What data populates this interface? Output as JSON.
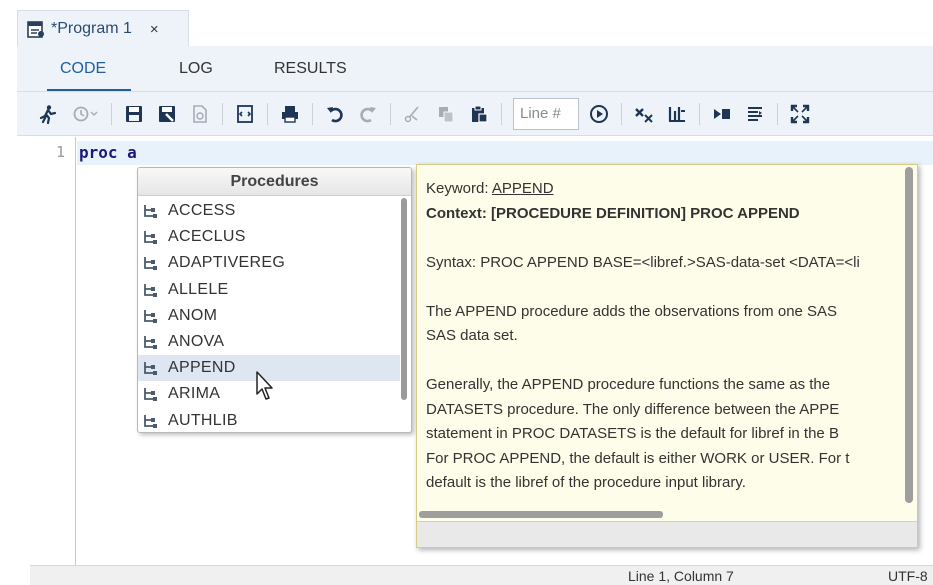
{
  "document_tab": {
    "title": "*Program 1",
    "close_glyph": "×",
    "icon": "sas-program-icon"
  },
  "subtabs": [
    {
      "label": "CODE",
      "active": true
    },
    {
      "label": "LOG",
      "active": false
    },
    {
      "label": "RESULTS",
      "active": false
    }
  ],
  "toolbar": {
    "line_placeholder": "Line #",
    "buttons": [
      "run-icon",
      "history-icon",
      "save-icon",
      "save-as-icon",
      "export-icon",
      "generate-code-icon",
      "print-icon",
      "undo-icon",
      "redo-icon",
      "cut-icon",
      "copy-icon",
      "paste-icon",
      "go-to-line-icon",
      "clear-icon",
      "format-icon",
      "snippet-icon",
      "options-icon",
      "maximize-icon"
    ]
  },
  "editor": {
    "line_number": "1",
    "code": "proc a"
  },
  "autocomplete": {
    "header": "Procedures",
    "items": [
      "ACCESS",
      "ACECLUS",
      "ADAPTIVEREG",
      "ALLELE",
      "ANOM",
      "ANOVA",
      "APPEND",
      "ARIMA",
      "AUTHLIB"
    ],
    "selected": "APPEND"
  },
  "help": {
    "keyword_label": "Keyword:",
    "keyword": "APPEND",
    "context": "Context: [PROCEDURE DEFINITION] PROC APPEND",
    "syntax": "Syntax: PROC APPEND BASE=<libref.>SAS-data-set <DATA=<li",
    "desc_line1": "The APPEND procedure adds the observations from one SAS",
    "desc_line2": "SAS data set.",
    "gen_line1": "Generally, the APPEND procedure functions the same as the",
    "gen_line2": "DATASETS procedure. The only difference between the APPE",
    "gen_line3": "statement in PROC DATASETS is the default for libref in the B",
    "gen_line4": "For PROC APPEND, the default is either WORK or USER. For t",
    "gen_line5": "default is the libref of the procedure input library."
  },
  "status": {
    "position": "Line 1, Column 7",
    "encoding": "UTF-8"
  },
  "colors": {
    "accent": "#1f5f9f",
    "toolbar_bg": "#eef3f9",
    "tooltip_bg": "#fefde9",
    "selected_row": "#dde6f1"
  }
}
